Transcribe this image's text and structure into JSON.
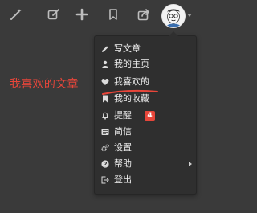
{
  "topbar": {
    "icons": [
      "magic-wand-icon",
      "edit-icon",
      "plus-icon",
      "bookmark-icon",
      "share-icon"
    ],
    "avatar": "avatar"
  },
  "annotation": {
    "text": "我喜欢的文章",
    "color": "#e8463a"
  },
  "menu": {
    "items": [
      {
        "label": "写文章",
        "icon": "pencil-icon"
      },
      {
        "label": "我的主页",
        "icon": "user-icon"
      },
      {
        "label": "我喜欢的",
        "icon": "heart-icon"
      },
      {
        "label": "我的收藏",
        "icon": "bookmark-icon"
      },
      {
        "label": "提醒",
        "icon": "bell-icon",
        "badge": "4"
      },
      {
        "label": "简信",
        "icon": "message-icon"
      },
      {
        "label": "设置",
        "icon": "gears-icon"
      },
      {
        "label": "帮助",
        "icon": "question-icon",
        "has_submenu": true
      },
      {
        "label": "登出",
        "icon": "logout-icon"
      }
    ]
  },
  "colors": {
    "background": "#3a3a3a",
    "menu_bg": "#2f2f2f",
    "accent_red": "#e8463a"
  }
}
